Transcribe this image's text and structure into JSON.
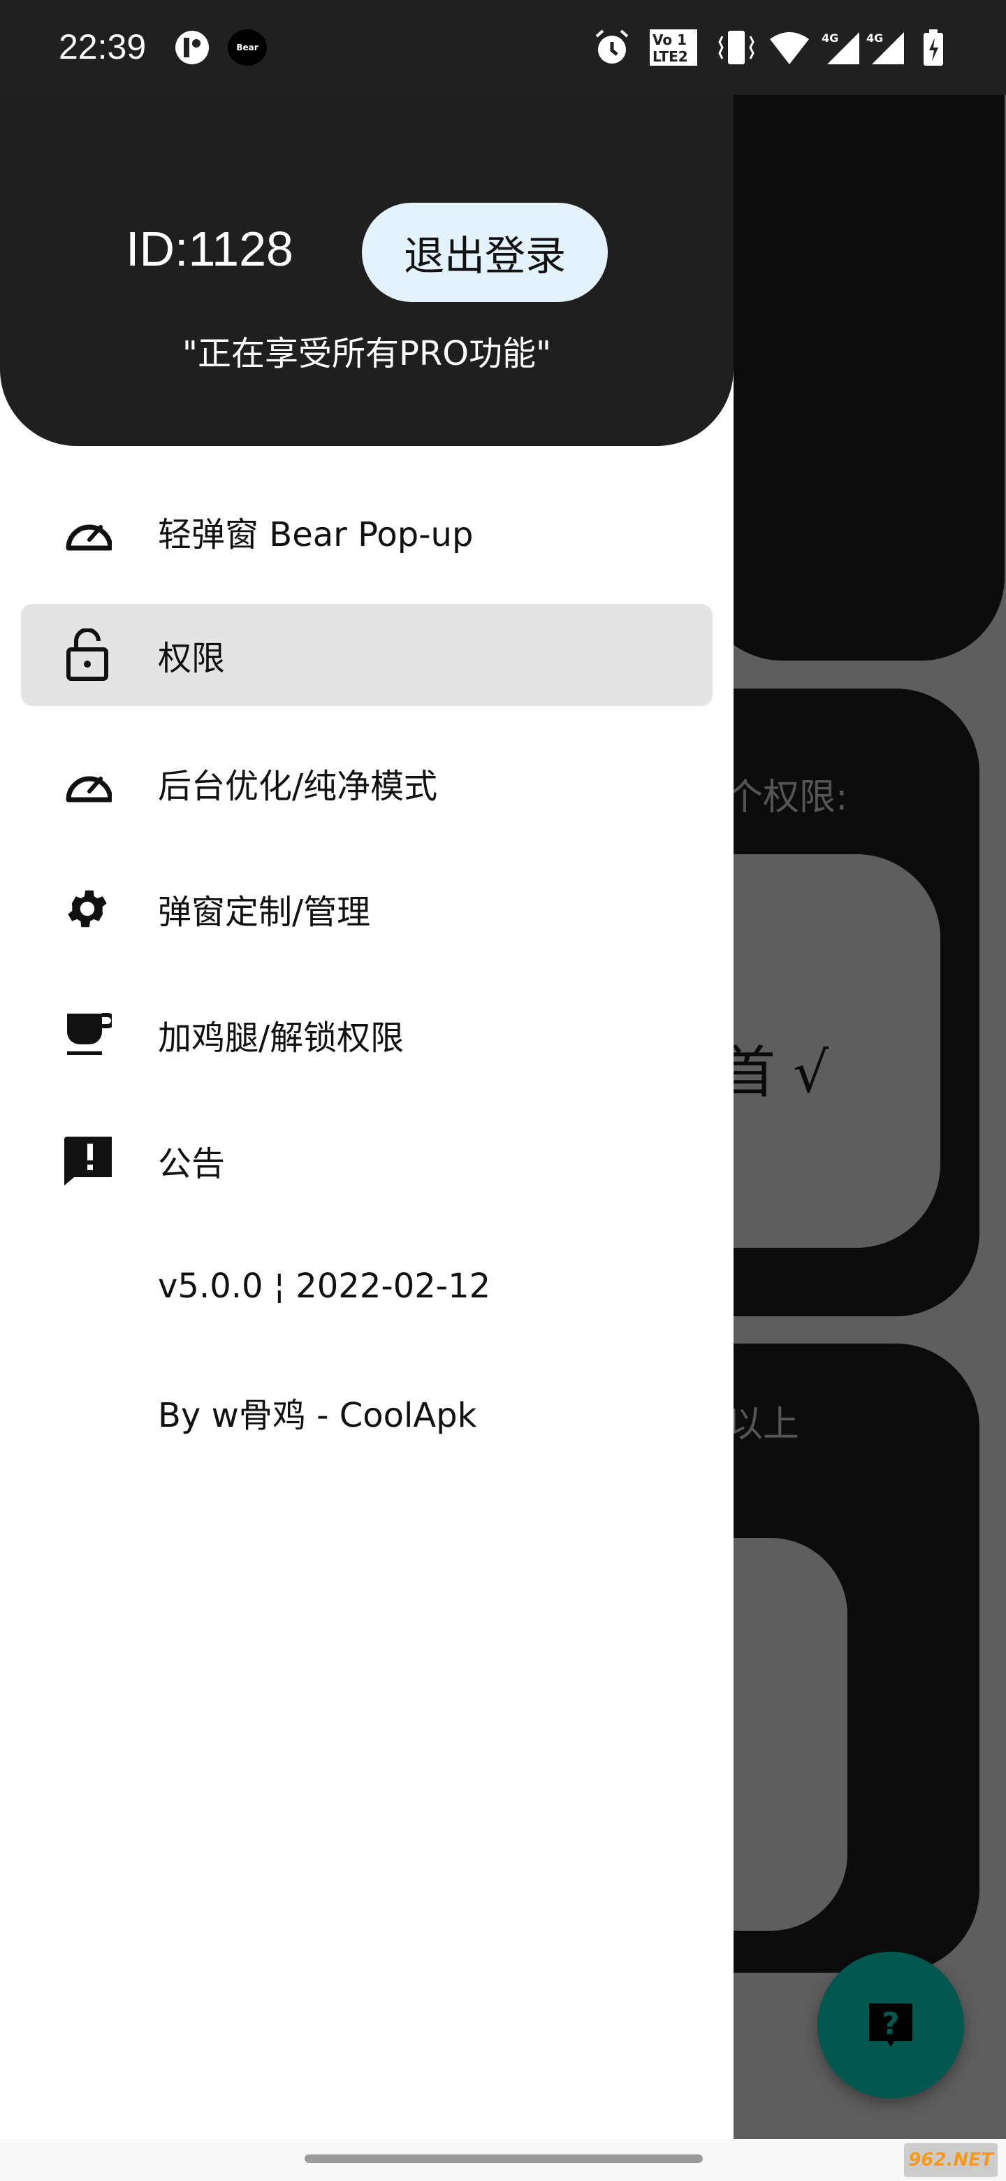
{
  "status_bar": {
    "time": "22:39",
    "icons": [
      "app-icon",
      "bear-icon",
      "alarm-icon",
      "volte-icon",
      "vibrate-icon",
      "wifi-icon",
      "signal-4g-icon",
      "signal-4g-icon",
      "battery-charging-icon"
    ],
    "network_label": "4G",
    "bear_label": "Bear"
  },
  "drawer": {
    "user_id": "ID:1128",
    "logout_label": "退出登录",
    "pro_status": "\"正在享受所有PRO功能\"",
    "items": [
      {
        "label": "轻弹窗 Bear Pop-up",
        "icon": "speedometer-icon"
      },
      {
        "label": "权限",
        "icon": "lock-open-icon",
        "selected": true
      },
      {
        "label": "后台优化/纯净模式",
        "icon": "speedometer-icon"
      },
      {
        "label": "弹窗定制/管理",
        "icon": "gear-icon"
      },
      {
        "label": "加鸡腿/解锁权限",
        "icon": "coffee-icon"
      },
      {
        "label": "公告",
        "icon": "announcement-icon"
      }
    ],
    "version": "v5.0.0 ¦ 2022-02-12",
    "author": "By w骨鸡 - CoolApk"
  },
  "background": {
    "perm_title": "个权限:",
    "check_text": "首 √",
    "version_text": "以上"
  },
  "fab": {
    "icon": "help-bubble-icon",
    "color": "#02574f"
  },
  "watermark": "962.NET",
  "colors": {
    "header": "#1f1f1f",
    "logout_bg": "#e3f2fb",
    "selected": "#e4e4e4"
  }
}
